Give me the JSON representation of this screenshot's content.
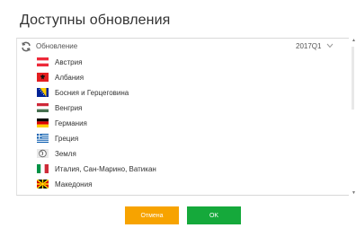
{
  "dialog": {
    "title": "Доступны обновления"
  },
  "group": {
    "label": "Обновление",
    "version": "2017Q1",
    "icon": "refresh-icon",
    "expand_icon": "chevron-down-icon"
  },
  "items": [
    {
      "label": "Австрия",
      "flag": "austria-flag-icon"
    },
    {
      "label": "Албания",
      "flag": "albania-flag-icon"
    },
    {
      "label": "Босния и Герцеговина",
      "flag": "bosnia-flag-icon"
    },
    {
      "label": "Венгрия",
      "flag": "hungary-flag-icon"
    },
    {
      "label": "Германия",
      "flag": "germany-flag-icon"
    },
    {
      "label": "Греция",
      "flag": "greece-flag-icon"
    },
    {
      "label": "Земля",
      "flag": "earth-icon"
    },
    {
      "label": "Италия, Сан-Марино, Ватикан",
      "flag": "italy-flag-icon"
    },
    {
      "label": "Македония",
      "flag": "macedonia-flag-icon"
    }
  ],
  "buttons": {
    "cancel_label": "Отмена",
    "ok_label": "OK"
  },
  "colors": {
    "cancel": "#f7a300",
    "ok": "#15a93b"
  }
}
